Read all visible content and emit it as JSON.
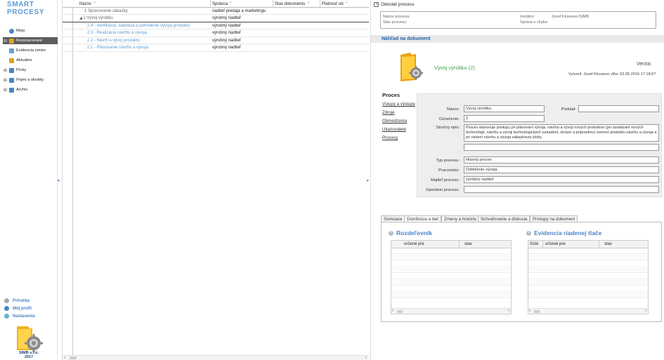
{
  "app": {
    "logo_line1": "SMART",
    "logo_line2": "PROCESY"
  },
  "sidebar": {
    "items": [
      {
        "label": "Moje",
        "expand": "",
        "icon_color": "#4a86c5"
      },
      {
        "label": "Rozpracované",
        "expand": "⊞",
        "icon_color": "#e0a020"
      },
      {
        "label": "Evidencia zmien",
        "expand": "",
        "icon_color": "#6a9fd5"
      },
      {
        "label": "Aktuálne",
        "expand": "",
        "icon_color": "#e0a020"
      },
      {
        "label": "Prvky",
        "expand": "⊞",
        "icon_color": "#4a86c5"
      },
      {
        "label": "Pojmi a skratky",
        "expand": "⊞",
        "icon_color": "#4a86c5"
      },
      {
        "label": "Archív",
        "expand": "⊞",
        "icon_color": "#4a86c5"
      }
    ],
    "bottom": [
      {
        "label": "Príručka",
        "icon_color": "#aaaaaa"
      },
      {
        "label": "Môj profil",
        "icon_color": "#4a86c5"
      },
      {
        "label": "Nastavenia",
        "icon_color": "#6ab0d5"
      }
    ],
    "company_line1": "SIMB s.r.o.",
    "company_line2": "2017"
  },
  "grid": {
    "columns": [
      "Názov",
      "Správca",
      "Stav dokumentu",
      "Platnosť od"
    ],
    "sort_glyph": "⌃",
    "rows": [
      {
        "name": "1 Spracovanie zákazky",
        "owner": "riaditeľ predaja a marketingu"
      },
      {
        "name": "2 Vývoj výrobku",
        "owner": "výrobný riaditeľ"
      },
      {
        "name": "2.4 - Verifikácia, validácia a potvrdenie vývoja produktu",
        "owner": "výrobný riaditeľ"
      },
      {
        "name": "2.3 - Realizácia návrhu a vývoja",
        "owner": "výrobný riaditeľ"
      },
      {
        "name": "2.2 - Návrh a vývoj produktu",
        "owner": "výrobný riaditeľ"
      },
      {
        "name": "2.1 - Plánovanie návrhu a vývoja",
        "owner": "výrobný riaditeľ"
      }
    ],
    "group_toggle": "◢"
  },
  "detail": {
    "send_label": "Odoslať process",
    "info": {
      "nazov_label": "Názov procesu:",
      "stav_label": "Stav procesu:",
      "iniciator_label": "Iniciátor:",
      "iniciator_value": "Jozef Kluvanec/SIMB",
      "sprava_label": "Správa o chybe:"
    },
    "doc_title": "Náhľad na dokument",
    "process_title": "Vývoj výrobku (2)",
    "version_label": "Verzia:",
    "created_text": "Vytvoril: Jozef Kluvanec dňa: 02.05.2016 17:18:07",
    "nav_title": "Proces",
    "nav_links": [
      "Vstupy a výstupy",
      "Zdroje",
      "Obmedzenia",
      "Ukazovatele",
      "Procesy"
    ],
    "form": {
      "nazov_label": "Názov:",
      "nazov_value": "Vývoj výrobku",
      "preklad_label": "Preklad:",
      "preklad_value": "",
      "oznacenie_label": "Označenie:",
      "oznacenie_value": "2",
      "opis_label": "Stručný opis:",
      "opis_value": "Proces stanovuje postupy pri plánovaní vývoja, návrhu a vývoji nových produktov (pri zavádzaní nových technológií, návrhu a vývoji technologických zariadení, strojov a prípravkov) overení produktu návrhu a vývoja a pri riešení návrhu a vývoja zákazkovej úlohy.",
      "extra_value": "",
      "typ_label": "Typ procesu:",
      "typ_value": "Hlavný proces",
      "pracovisko_label": "Pracovisko:",
      "pracovisko_value": "Oddelenie vývoja",
      "majitel_label": "Majiteľ procesu:",
      "majitel_value": "výrobný riaditeľ",
      "operatori_label": "Operátori procesu:",
      "operatori_value": ""
    },
    "tabs": [
      "Súvisiace",
      "Distribúcia a tlač",
      "Zmeny a história",
      "Schvaľovanie a diskusia",
      "Prístupy na dokument"
    ],
    "rozdelovnik": {
      "title": "Rozdeľovník",
      "cols": [
        "určené pre",
        "stav"
      ]
    },
    "evidencia": {
      "title": "Evidencia riadenej tlače",
      "cols": [
        "číslo",
        "určené pre",
        "stav"
      ]
    }
  }
}
